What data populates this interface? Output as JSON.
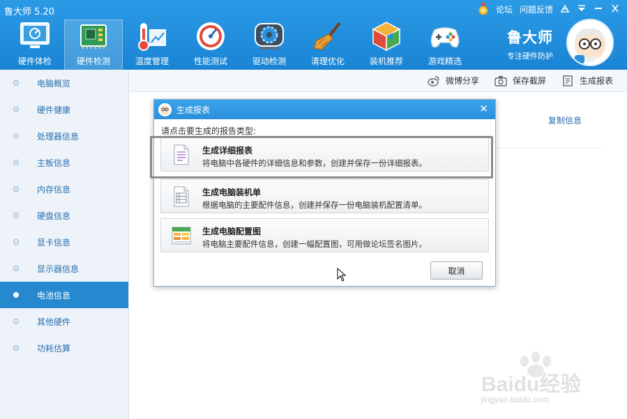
{
  "app": {
    "title": "鲁大师 5.20"
  },
  "top_links": {
    "forum": "论坛",
    "feedback": "问题反馈"
  },
  "nav": [
    {
      "label": "硬件体检",
      "icon": "monitor-icon"
    },
    {
      "label": "硬件检测",
      "icon": "circuit-board-icon",
      "active": true
    },
    {
      "label": "温度管理",
      "icon": "thermometer-icon"
    },
    {
      "label": "性能测试",
      "icon": "speedometer-icon"
    },
    {
      "label": "驱动检测",
      "icon": "gear-icon"
    },
    {
      "label": "清理优化",
      "icon": "broom-icon"
    },
    {
      "label": "装机推荐",
      "icon": "cube-icon"
    },
    {
      "label": "游戏精选",
      "icon": "gamepad-icon"
    }
  ],
  "brand": {
    "name": "鲁大师",
    "slogan": "专注硬件防护"
  },
  "sidebar": [
    {
      "label": "电脑概览"
    },
    {
      "label": "硬件健康"
    },
    {
      "label": "处理器信息"
    },
    {
      "label": "主板信息"
    },
    {
      "label": "内存信息"
    },
    {
      "label": "硬盘信息"
    },
    {
      "label": "显卡信息"
    },
    {
      "label": "显示器信息"
    },
    {
      "label": "电池信息",
      "active": true
    },
    {
      "label": "其他硬件"
    },
    {
      "label": "功耗估算"
    }
  ],
  "toolbar": {
    "weibo": "微博分享",
    "screenshot": "保存截屏",
    "report": "生成报表"
  },
  "content": {
    "copy_info": "复制信息"
  },
  "dialog": {
    "title": "生成报表",
    "close": "✕",
    "prompt": "请点击要生成的报告类型:",
    "options": [
      {
        "title": "生成详细报表",
        "desc": "将电脑中各硬件的详细信息和参数，创建并保存一份详细报表。"
      },
      {
        "title": "生成电脑装机单",
        "desc": "根据电脑的主要配件信息，创建并保存一份电脑装机配置清单。"
      },
      {
        "title": "生成电脑配置图",
        "desc": "将电脑主要配件信息，创建一幅配置图，可用做论坛签名图片。"
      }
    ],
    "cancel": "取消"
  },
  "watermark": {
    "text": "Baidu经验",
    "sub": "jingyan.baidu.com"
  },
  "colors": {
    "header": "#1f8fdb",
    "sidebar_active": "#2689cf",
    "link": "#2a6fb0"
  }
}
